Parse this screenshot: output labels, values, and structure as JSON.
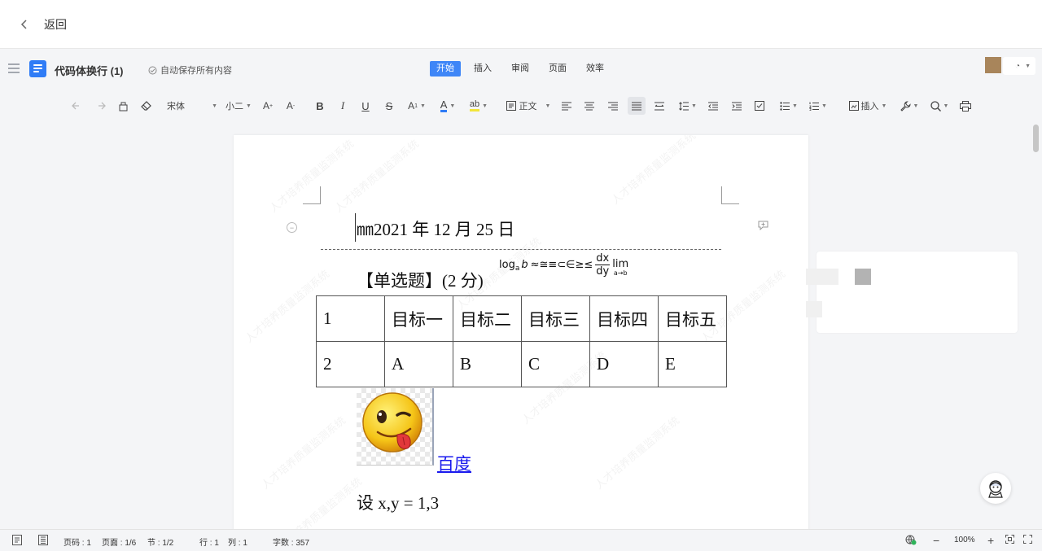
{
  "topbar": {
    "back_label": "返回"
  },
  "docbar": {
    "title": "代码体换行 (1)",
    "autosave": "自动保存所有内容",
    "tabs": [
      "开始",
      "插入",
      "审阅",
      "页面",
      "效率"
    ],
    "active_tab": "开始"
  },
  "toolbar": {
    "font_name": "宋体",
    "font_size": "小二",
    "style_label": "正文",
    "insert_label": "插入"
  },
  "document": {
    "date_line": "㎜2021 年 12 月 25 日",
    "question": "【单选题】(2 分)",
    "formula": {
      "log_prefix": "log",
      "log_base": "a",
      "log_arg": "b",
      "symbols": "≈≅≡⊂∈≥≤",
      "frac_num": "dx",
      "frac_den": "dy",
      "lim": "lim",
      "lim_sub": "a→b"
    },
    "table": [
      [
        "1",
        "目标一",
        "目标二",
        "目标三",
        "目标四",
        "目标五"
      ],
      [
        "2",
        "A",
        "B",
        "C",
        "D",
        "E"
      ]
    ],
    "link_text": "百度",
    "set_line": "设 x,y = 1,3",
    "watermark": "人才培养质量监测系统"
  },
  "status": {
    "page_code": "页码 : 1",
    "page": "页面 : 1/6",
    "section": "节 : 1/2",
    "row": "行 : 1",
    "col": "列 : 1",
    "words": "字数 : 357",
    "zoom": "100%"
  },
  "colors": {
    "accent": "#3f86f7",
    "doc_icon": "#2f7cf6",
    "link": "#1a1aee"
  }
}
